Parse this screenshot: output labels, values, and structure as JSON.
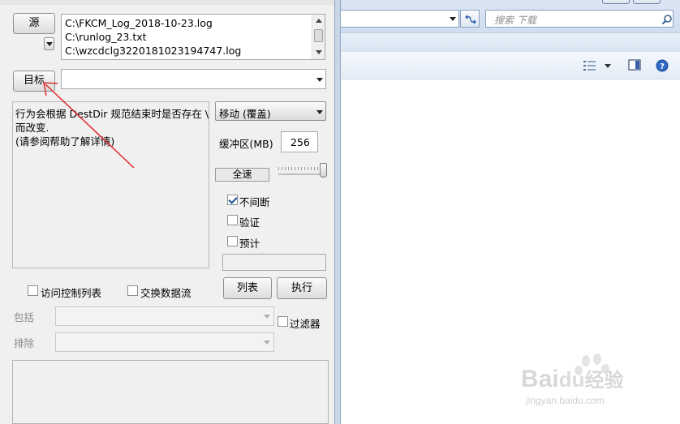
{
  "app": {
    "source_button": "源",
    "source_files": [
      "C:\\FKCM_Log_2018-10-23.log",
      "C:\\runlog_23.txt",
      "C:\\wzcdclg3220181023194747.log"
    ],
    "target_button": "目标",
    "target_value": "",
    "description_lines": [
      "行为会根据 DestDir 规范结束时是否存在 \\",
      "而改变.",
      "(请参阅帮助了解详情)"
    ],
    "mode_select": "移动 (覆盖)",
    "buffer_label": "缓冲区(MB)",
    "buffer_value": "256",
    "speed_label": "全速",
    "options": [
      {
        "label": "不间断",
        "checked": true
      },
      {
        "label": "验证",
        "checked": false
      },
      {
        "label": "预计",
        "checked": false
      }
    ],
    "acl_label": "访问控制列表",
    "exchange_stream_label": "交换数据流",
    "list_button": "列表",
    "execute_button": "执行",
    "include_label": "包括",
    "exclude_label": "排除",
    "filter_label": "过滤器",
    "slider_level": 1.0
  },
  "explorer": {
    "search_placeholder": "搜索 下载"
  },
  "annotation": {
    "color": "#e02a2a"
  },
  "watermark": {
    "brand": "Bai",
    "brand_suffix": "经验",
    "url": "jingyan.baidu.com"
  }
}
